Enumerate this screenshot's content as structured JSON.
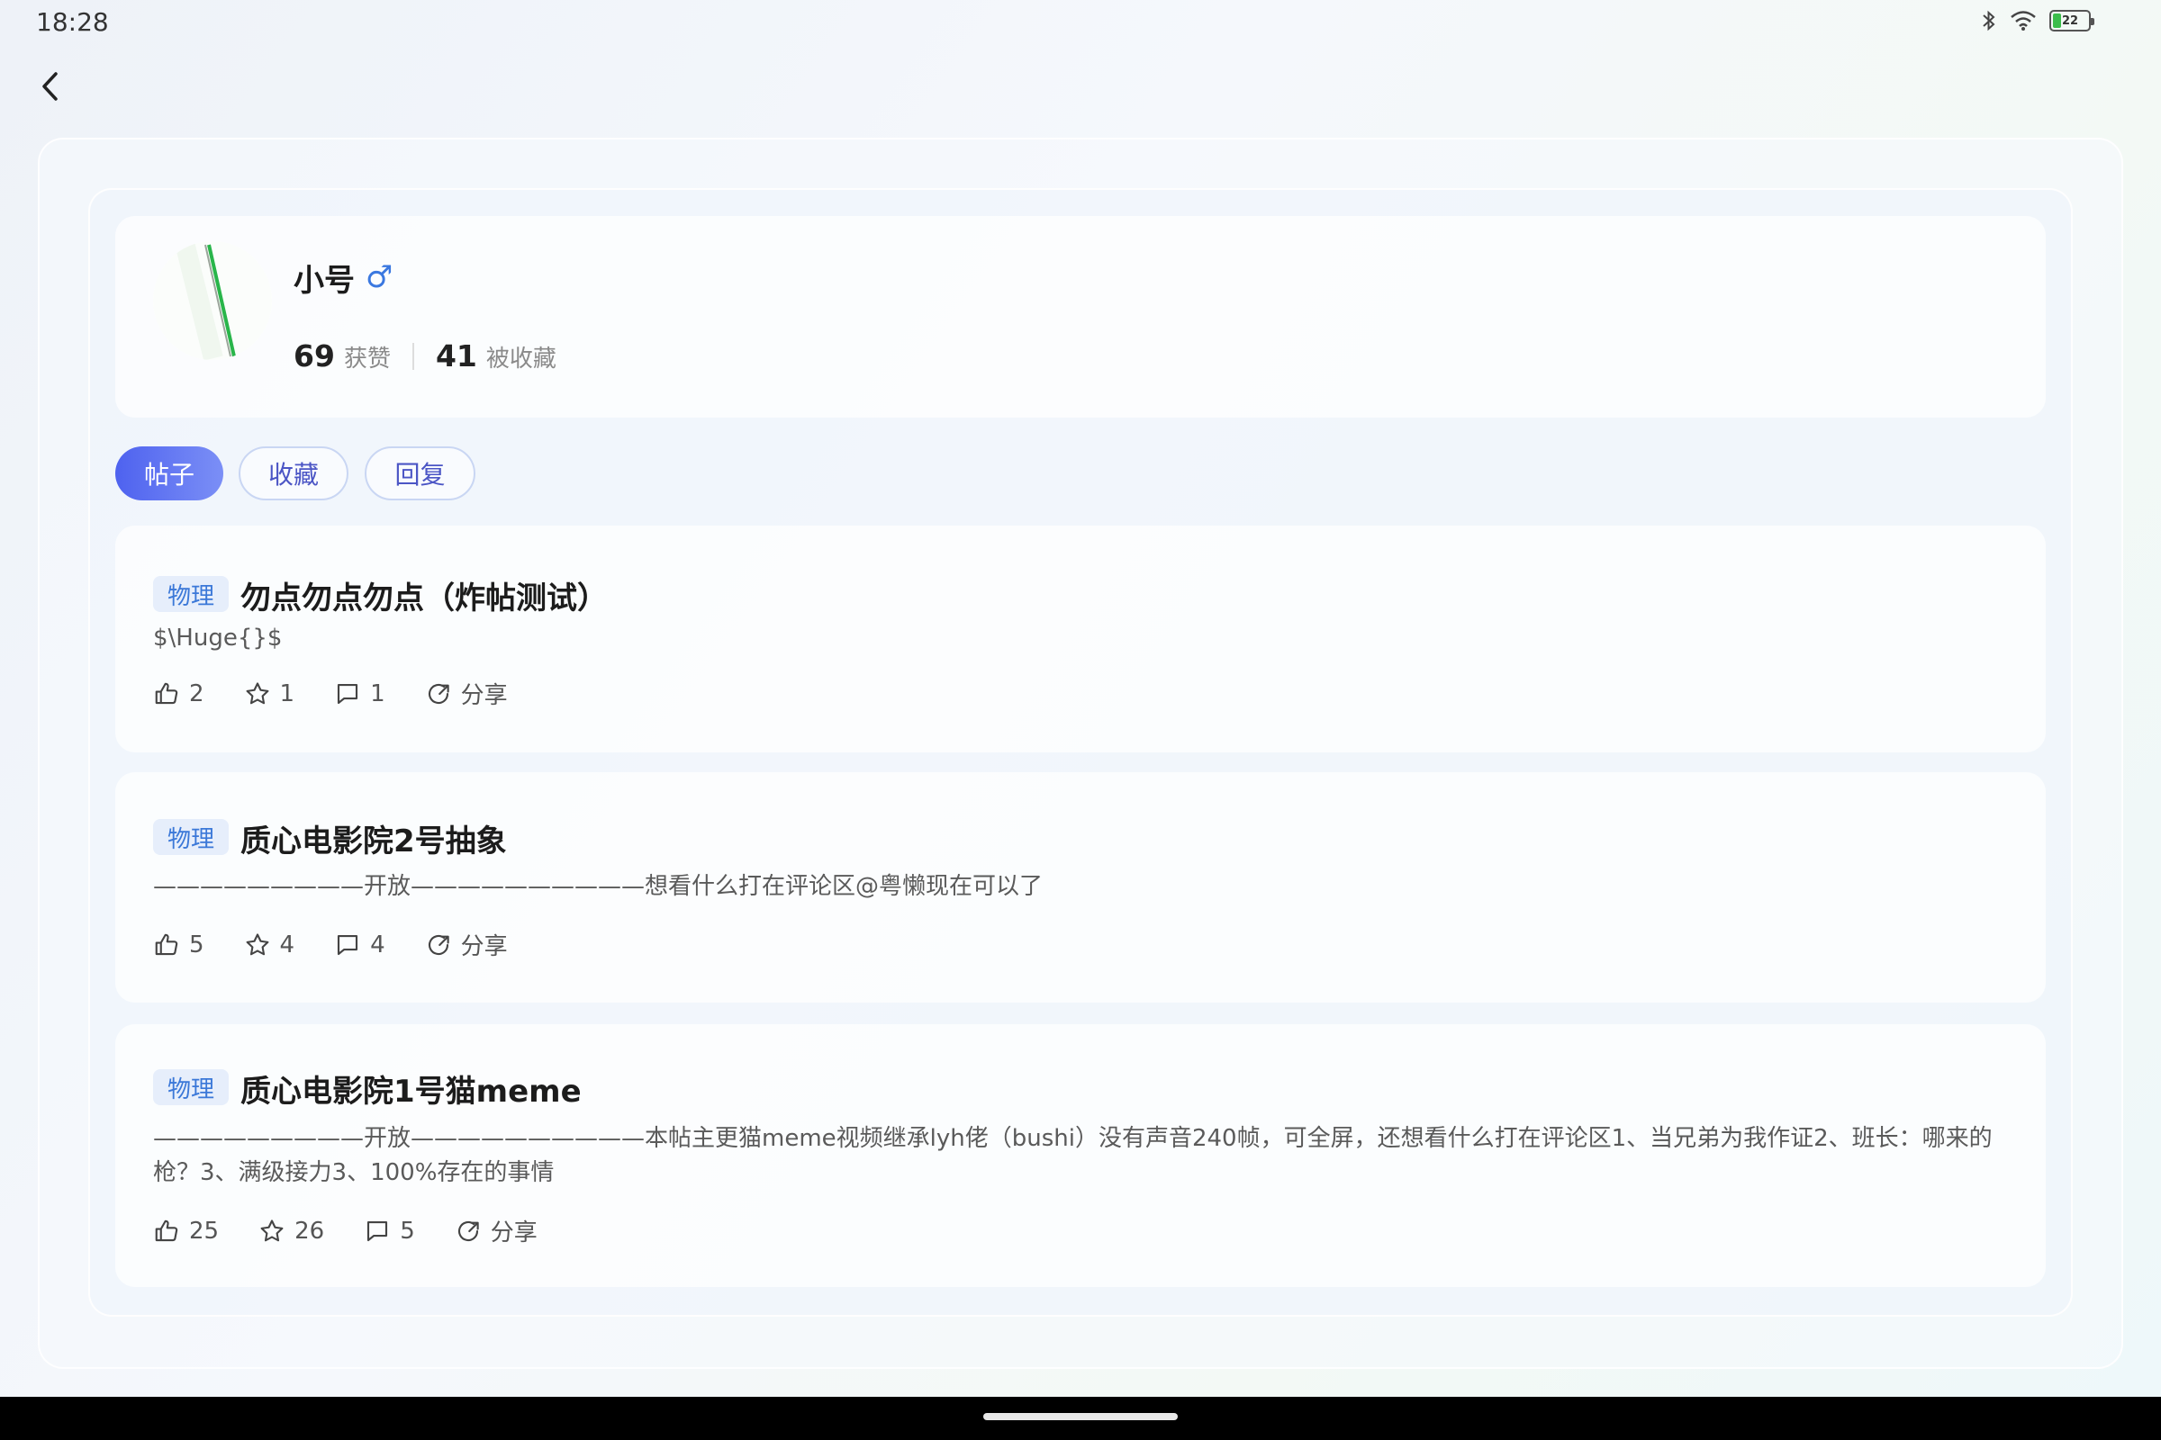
{
  "status_bar": {
    "time": "18:28",
    "battery": "22"
  },
  "profile": {
    "name": "小号",
    "gender_symbol": "♂",
    "likes_count": "69",
    "likes_label": "获赞",
    "favorited_count": "41",
    "favorited_label": "被收藏"
  },
  "tabs": [
    {
      "label": "帖子",
      "active": true
    },
    {
      "label": "收藏",
      "active": false
    },
    {
      "label": "回复",
      "active": false
    }
  ],
  "posts": [
    {
      "category": "物理",
      "title": "勿点勿点勿点（炸帖测试）",
      "excerpt": "$\\Huge{}$",
      "likes": "2",
      "favorites": "1",
      "comments": "1",
      "share": "分享"
    },
    {
      "category": "物理",
      "title": "质心电影院2号抽象",
      "excerpt": "—————————开放——————————想看什么打在评论区@粤懒现在可以了",
      "likes": "5",
      "favorites": "4",
      "comments": "4",
      "share": "分享"
    },
    {
      "category": "物理",
      "title": "质心电影院1号猫meme",
      "excerpt": "—————————开放——————————本帖主更猫meme视频继承lyh佬（bushi）没有声音240帧，可全屏，还想看什么打在评论区1、当兄弟为我作证2、班长：哪来的枪？3、满级接力3、100%存在的事情",
      "likes": "25",
      "favorites": "26",
      "comments": "5",
      "share": "分享"
    }
  ],
  "colors": {
    "accent": "#4e62ef",
    "tag_text": "#3b78d8",
    "tag_bg": "#e6eefb",
    "gender": "#3a78e0"
  },
  "icons": {
    "back": "chevron-left-icon",
    "like": "thumb-up-icon",
    "favorite": "star-icon",
    "comment": "comment-icon",
    "share": "share-icon"
  }
}
